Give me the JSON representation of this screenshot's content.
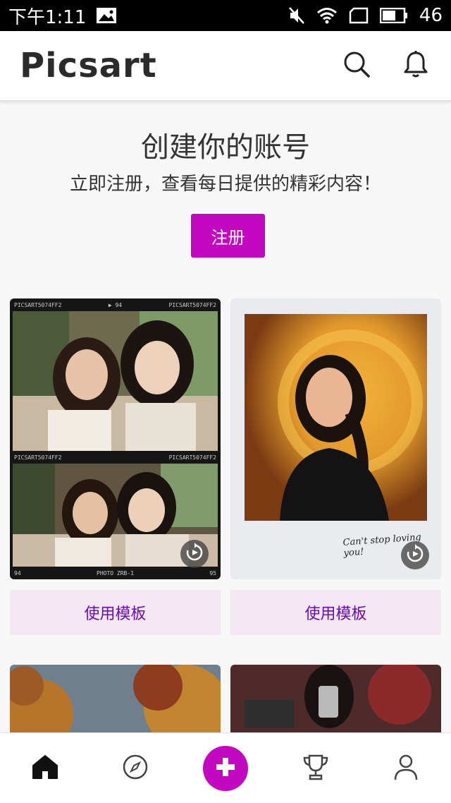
{
  "status_bar": {
    "time": "下午1:11",
    "battery_level": "46"
  },
  "header": {
    "logo_text": "Picsart"
  },
  "hero": {
    "title": "创建你的账号",
    "subtitle": "立即注册，查看每日提供的精彩内容！",
    "signup_label": "注册"
  },
  "templates": [
    {
      "strip_top_left": "PICSART5074FF2",
      "strip_top_mid": "▶ 94",
      "strip_top_right": "PICSART5074FF2",
      "strip_mid_left": "PICSART5074FF2",
      "strip_mid_right": "PICSART5074FF2",
      "strip_bottom_left": "94",
      "strip_bottom_mid": "PHOTO ZRB-1",
      "strip_bottom_right": "95",
      "use_label": "使用模板"
    },
    {
      "caption": "Can't stop loving you!",
      "use_label": "使用模板"
    }
  ],
  "colors": {
    "brand": "#c209c1",
    "use_button_bg": "#f3e7f3",
    "use_button_text": "#6a0bb8"
  },
  "icons": [
    "search-icon",
    "bell-icon",
    "home-icon",
    "compass-icon",
    "plus-icon",
    "trophy-icon",
    "profile-icon",
    "replay-icon"
  ]
}
